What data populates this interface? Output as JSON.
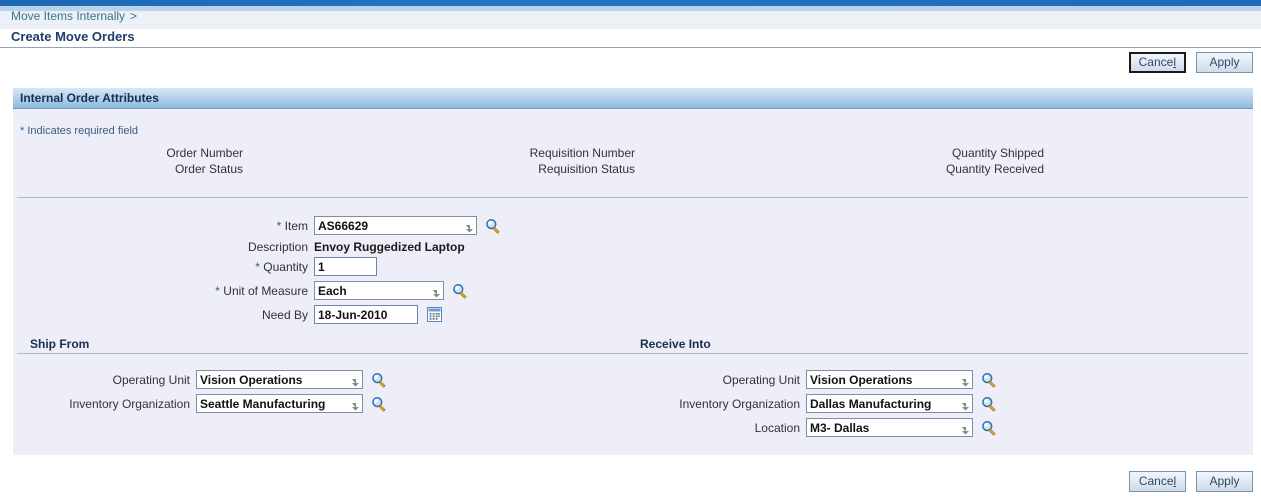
{
  "window": {
    "title": "Create Move Orders"
  },
  "breadcrumb": {
    "parent_label": "Move Items Internally",
    "separator": ">"
  },
  "page": {
    "title": "Create Move Orders"
  },
  "actions": {
    "cancel_label": "Cancel",
    "cancel_accesskey": "l",
    "cancel_prefix": "Cance",
    "apply_label": "Apply"
  },
  "region": {
    "title": "Internal Order Attributes",
    "required_note": "* Indicates required field"
  },
  "readonly_fields": {
    "left": [
      {
        "label": "Order Number",
        "value": ""
      },
      {
        "label": "Order Status",
        "value": ""
      }
    ],
    "middle": [
      {
        "label": "Requisition Number",
        "value": ""
      },
      {
        "label": "Requisition Status",
        "value": ""
      }
    ],
    "right": [
      {
        "label": "Quantity Shipped",
        "value": ""
      },
      {
        "label": "Quantity Received",
        "value": ""
      }
    ]
  },
  "item_details": {
    "item": {
      "label": "Item",
      "required_marker": "*",
      "value": "AS66629",
      "lov_icon": "magnifier-icon"
    },
    "description": {
      "label": "Description",
      "value": "Envoy Ruggedized Laptop"
    },
    "quantity": {
      "label": "Quantity",
      "required_marker": "*",
      "value": "1"
    },
    "unit_of_measure": {
      "label": "Unit of Measure",
      "required_marker": "*",
      "value": "Each",
      "lov_icon": "magnifier-icon"
    },
    "need_by": {
      "label": "Need By",
      "value": "18-Jun-2010",
      "picker_icon": "calendar-icon"
    }
  },
  "ship_from": {
    "title": "Ship From",
    "operating_unit": {
      "label": "Operating Unit",
      "value": "Vision Operations",
      "lov_icon": "magnifier-icon"
    },
    "inventory_organization": {
      "label": "Inventory Organization",
      "value": "Seattle Manufacturing",
      "lov_icon": "magnifier-icon"
    }
  },
  "receive_into": {
    "title": "Receive Into",
    "operating_unit": {
      "label": "Operating Unit",
      "value": "Vision Operations",
      "lov_icon": "magnifier-icon"
    },
    "inventory_organization": {
      "label": "Inventory Organization",
      "value": "Dallas Manufacturing",
      "lov_icon": "magnifier-icon"
    },
    "location": {
      "label": "Location",
      "value": "M3- Dallas",
      "lov_icon": "magnifier-icon"
    }
  },
  "colors": {
    "brand_blue": "#1f6ab8",
    "panel_bg": "#edeef7",
    "header_gradient_top": "#d7e7f5",
    "header_gradient_bottom": "#8ebadd",
    "link": "#36748f",
    "title": "#1f3c6e",
    "required": "#3a5b84"
  }
}
